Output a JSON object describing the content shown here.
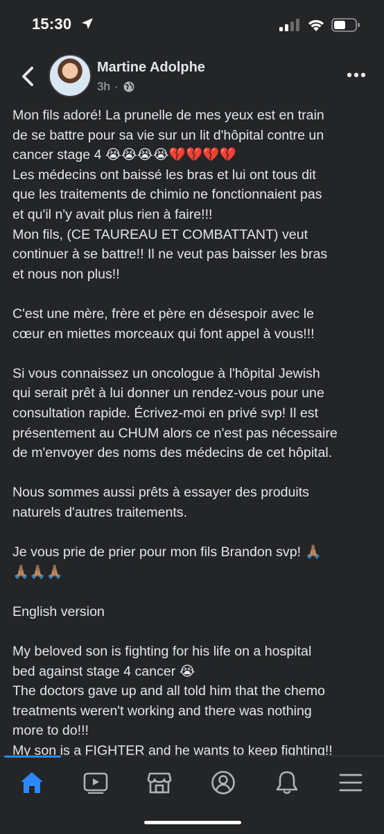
{
  "status_bar": {
    "time": "15:30"
  },
  "header": {
    "author": "Martine Adolphe",
    "time_ago": "3h",
    "dot": "·"
  },
  "post": {
    "paragraphs": [
      "Mon fils adoré! La prunelle de mes yeux est en train\nde se battre pour sa vie sur un lit d'hôpital contre un\ncancer stage 4 😭😭😭😭💔💔💔💔\nLes médecins ont baissé les bras et lui ont tous dit\nque les traitements de chimio ne fonctionnaient pas\net qu'il n'y avait plus rien à faire!!!\nMon fils, (CE TAUREAU ET COMBATTANT) veut\ncontinuer à se battre!! Il ne veut pas baisser les bras\net nous non plus!!",
      "C'est une mère, frère et père en désespoir avec le\ncœur en miettes morceaux qui font appel à vous!!!",
      "Si vous connaissez un oncologue à l'hôpital Jewish\nqui serait prêt à lui donner un rendez-vous pour une\nconsultation rapide. Écrivez-moi en privé svp! Il est\nprésentement au CHUM alors ce n'est pas nécessaire\nde m'envoyer des noms des médecins de cet hôpital.",
      "Nous sommes aussi prêts à essayer des produits\nnaturels d'autres traitements.",
      "Je vous prie de prier pour mon fils Brandon svp! 🙏🏽\n🙏🏽🙏🏽🙏🏽",
      "English version",
      "My beloved son is fighting for his life on a hospital\nbed against stage 4 cancer 😭\nThe doctors gave up and all told him that the chemo\ntreatments weren't working and there was nothing\nmore to do!!!\nMy son is a FIGHTER and he wants to keep fighting!!"
    ]
  },
  "tabbar": {
    "tabs": [
      {
        "icon": "home-icon",
        "active": true
      },
      {
        "icon": "video-icon",
        "active": false
      },
      {
        "icon": "marketplace-icon",
        "active": false
      },
      {
        "icon": "profile-icon",
        "active": false
      },
      {
        "icon": "bell-icon",
        "active": false
      },
      {
        "icon": "menu-icon",
        "active": false
      }
    ]
  },
  "colors": {
    "background": "#242526",
    "text": "#e4e6eb",
    "secondary_text": "#b0b3b8",
    "accent": "#2d88ff"
  }
}
